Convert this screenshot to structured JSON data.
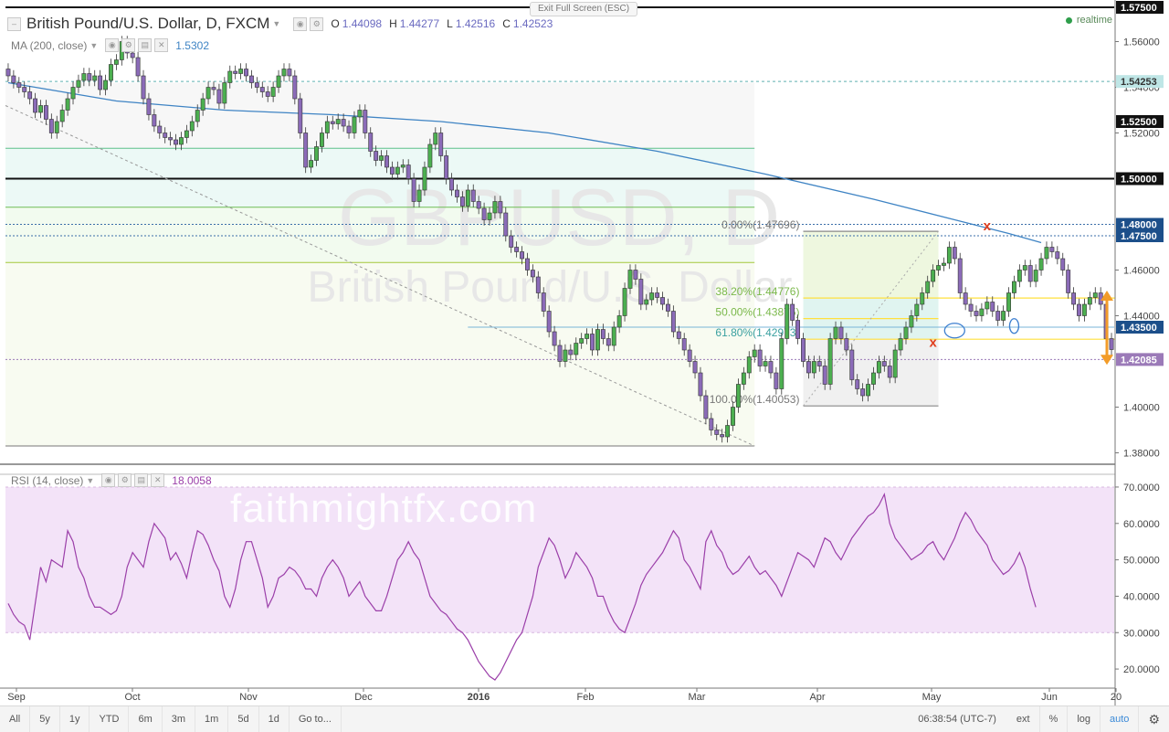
{
  "app": {
    "exit_fullscreen": "Exit Full Screen (ESC)",
    "realtime": "realtime"
  },
  "legend": {
    "symbol": "British Pound/U.S. Dollar, D, FXCM",
    "o_label": "O",
    "o_value": "1.44098",
    "h_label": "H",
    "h_value": "1.44277",
    "l_label": "L",
    "l_value": "1.42516",
    "c_label": "C",
    "c_value": "1.42523",
    "ma_label": "MA (200, close)",
    "ma_value": "1.5302",
    "rsi_label": "RSI (14, close)",
    "rsi_value": "18.0058"
  },
  "watermark": {
    "big": "GBPUSD, D",
    "sub": "British Pound/U.S. Dollar",
    "site": "faithmightfx.com"
  },
  "toolbar": {
    "ranges": [
      "All",
      "5y",
      "1y",
      "YTD",
      "6m",
      "3m",
      "1m",
      "5d",
      "1d",
      "Go to..."
    ],
    "time": "06:38:54 (UTC-7)",
    "right": [
      "ext",
      "%",
      "log",
      "auto"
    ],
    "settings_icon": "gear-icon"
  },
  "colors": {
    "up": "#4caf50",
    "down": "#8b6bb8",
    "ma": "#3f84c4",
    "rsi_line": "#9b3fa9",
    "rsi_band": "#f3e3f8",
    "fib": "#ffe03d",
    "arrow": "#f39c28",
    "marker_x": "#e04020"
  },
  "chart_data": {
    "type": "candlestick",
    "price_axis": {
      "ticks": [
        "1.56000",
        "1.54000",
        "1.52000",
        "1.46000",
        "1.44000",
        "1.40000",
        "1.38000"
      ],
      "range": [
        1.375,
        1.575
      ]
    },
    "price_badges": [
      {
        "label": "1.57500",
        "value": 1.575,
        "style": "dark"
      },
      {
        "label": "1.54253",
        "value": 1.54253,
        "style": "teal"
      },
      {
        "label": "1.52500",
        "value": 1.525,
        "style": "dark"
      },
      {
        "label": "1.50000",
        "value": 1.5,
        "style": "dark"
      },
      {
        "label": "1.48000",
        "value": 1.48,
        "style": "blue"
      },
      {
        "label": "1.47500",
        "value": 1.475,
        "style": "blue"
      },
      {
        "label": "1.43500",
        "value": 1.435,
        "style": "blue"
      },
      {
        "label": "1.42085",
        "value": 1.42085,
        "style": "purple"
      }
    ],
    "time_axis": [
      "Sep",
      "Oct",
      "Nov",
      "Dec",
      "2016",
      "Feb",
      "Mar",
      "Apr",
      "May",
      "Jun",
      "20"
    ],
    "fib_levels": [
      {
        "label": "0.00%(1.47696)",
        "value": 1.47696
      },
      {
        "label": "38.20%(1.44776)",
        "value": 1.44776
      },
      {
        "label": "50.00%(1.43875)",
        "value": 1.43875
      },
      {
        "label": "61.80%(1.42973)",
        "value": 1.42973
      },
      {
        "label": "100.00%(1.40053)",
        "value": 1.40053
      }
    ],
    "horizontal_levels": [
      1.5133,
      1.4875,
      1.4633
    ],
    "close": [
      1.545,
      1.542,
      1.54,
      1.538,
      1.535,
      1.529,
      1.532,
      1.526,
      1.52,
      1.525,
      1.53,
      1.535,
      1.54,
      1.543,
      1.546,
      1.543,
      1.545,
      1.539,
      1.543,
      1.55,
      1.552,
      1.56,
      1.555,
      1.553,
      1.545,
      1.535,
      1.528,
      1.523,
      1.52,
      1.518,
      1.517,
      1.515,
      1.518,
      1.521,
      1.525,
      1.53,
      1.535,
      1.54,
      1.539,
      1.533,
      1.542,
      1.547,
      1.546,
      1.548,
      1.545,
      1.542,
      1.54,
      1.538,
      1.536,
      1.54,
      1.545,
      1.548,
      1.545,
      1.535,
      1.52,
      1.505,
      1.508,
      1.514,
      1.52,
      1.525,
      1.524,
      1.526,
      1.523,
      1.52,
      1.527,
      1.53,
      1.52,
      1.512,
      1.508,
      1.51,
      1.505,
      1.502,
      1.505,
      1.506,
      1.5,
      1.49,
      1.495,
      1.505,
      1.515,
      1.52,
      1.51,
      1.5,
      1.495,
      1.492,
      1.488,
      1.495,
      1.49,
      1.487,
      1.482,
      1.485,
      1.49,
      1.485,
      1.475,
      1.47,
      1.468,
      1.465,
      1.46,
      1.457,
      1.45,
      1.442,
      1.433,
      1.427,
      1.42,
      1.425,
      1.423,
      1.428,
      1.43,
      1.432,
      1.425,
      1.434,
      1.43,
      1.427,
      1.435,
      1.44,
      1.452,
      1.46,
      1.456,
      1.445,
      1.447,
      1.45,
      1.448,
      1.445,
      1.442,
      1.433,
      1.43,
      1.425,
      1.42,
      1.415,
      1.405,
      1.395,
      1.39,
      1.388,
      1.387,
      1.392,
      1.4,
      1.41,
      1.415,
      1.422,
      1.425,
      1.418,
      1.42,
      1.415,
      1.408,
      1.43,
      1.445,
      1.438,
      1.43,
      1.42,
      1.415,
      1.42,
      1.418,
      1.41,
      1.43,
      1.435,
      1.43,
      1.425,
      1.412,
      1.408,
      1.405,
      1.41,
      1.415,
      1.42,
      1.418,
      1.413,
      1.425,
      1.43,
      1.435,
      1.44,
      1.445,
      1.45,
      1.455,
      1.46,
      1.462,
      1.463,
      1.47,
      1.465,
      1.45,
      1.445,
      1.442,
      1.44,
      1.443,
      1.446,
      1.442,
      1.438,
      1.442,
      1.45,
      1.455,
      1.46,
      1.462,
      1.455,
      1.46,
      1.465,
      1.47,
      1.468,
      1.465,
      1.46,
      1.45,
      1.445,
      1.44,
      1.445,
      1.448,
      1.45,
      1.445,
      1.43,
      1.4252
    ],
    "ma": {
      "name": "MA (200, close)",
      "x": [
        0,
        10,
        20,
        40,
        60,
        80,
        100,
        120,
        140,
        160,
        175,
        185,
        191
      ],
      "y": [
        1.542,
        1.538,
        1.534,
        1.53,
        1.528,
        1.525,
        1.52,
        1.512,
        1.502,
        1.491,
        1.482,
        1.476,
        1.472
      ]
    },
    "rsi": {
      "ticks": [
        "70.0000",
        "60.0000",
        "50.0000",
        "40.0000",
        "30.0000",
        "20.0000"
      ],
      "range": [
        15,
        73
      ],
      "overbought": 70,
      "oversold": 30,
      "values": [
        38,
        35,
        33,
        32,
        28,
        38,
        48,
        44,
        50,
        49,
        48,
        58,
        55,
        48,
        45,
        40,
        37,
        37,
        36,
        35,
        36,
        40,
        48,
        52,
        50,
        48,
        55,
        60,
        58,
        56,
        50,
        52,
        49,
        45,
        52,
        58,
        57,
        54,
        50,
        47,
        40,
        37,
        42,
        50,
        55,
        55,
        50,
        45,
        37,
        40,
        45,
        46,
        48,
        47,
        45,
        42,
        42,
        40,
        45,
        48,
        50,
        48,
        45,
        40,
        42,
        44,
        40,
        38,
        36,
        36,
        40,
        45,
        50,
        52,
        55,
        52,
        50,
        45,
        40,
        38,
        36,
        35,
        33,
        31,
        30,
        28,
        25,
        22,
        20,
        18,
        17,
        19,
        22,
        25,
        28,
        30,
        35,
        40,
        48,
        52,
        56,
        54,
        50,
        45,
        48,
        52,
        50,
        48,
        45,
        40,
        40,
        36,
        33,
        31,
        30,
        34,
        38,
        43,
        46,
        48,
        50,
        52,
        55,
        58,
        56,
        50,
        48,
        45,
        42,
        55,
        58,
        54,
        52,
        48,
        46,
        47,
        49,
        51,
        48,
        46,
        47,
        45,
        43,
        40,
        44,
        48,
        52,
        51,
        50,
        48,
        52,
        56,
        55,
        52,
        50,
        53,
        56,
        58,
        60,
        62,
        63,
        65,
        68,
        60,
        56,
        54,
        52,
        50,
        51,
        52,
        54,
        55,
        52,
        50,
        53,
        56,
        60,
        63,
        61,
        58,
        56,
        54,
        50,
        48,
        46,
        47,
        49,
        52,
        48,
        42,
        37
      ]
    }
  }
}
